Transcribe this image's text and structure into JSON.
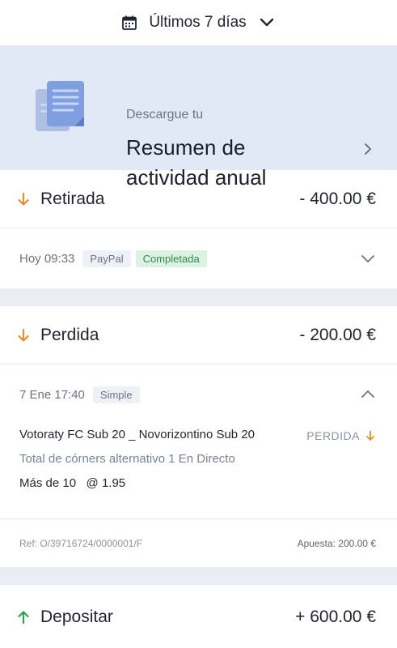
{
  "header": {
    "period_label": "Últimos 7 días",
    "icons": [
      "calendar-icon",
      "chevron-down-icon"
    ]
  },
  "banner": {
    "kicker": "Descargue tu",
    "title": "Resumen de actividad anual",
    "icons": [
      "document-icon",
      "chevron-right-icon"
    ]
  },
  "transactions": [
    {
      "type": "Retirada",
      "amount": "- 400.00 €",
      "direction": "down",
      "date": "Hoy 09:33",
      "badges": [
        "PayPal",
        "Completada"
      ]
    },
    {
      "type": "Perdida",
      "amount": "- 200.00 €",
      "direction": "down",
      "date": "7 Ene 17:40",
      "badges": [
        "Simple"
      ],
      "bet": {
        "match": "Votoraty FC Sub 20 _ Novorizontino Sub 20",
        "result": "PERDIDA",
        "market": "Total de córners alternativo 1 En Directo",
        "selection": "Más de 10   @ 1.95",
        "ref": "Ref: O/39716724/0000001/F",
        "stake": "Apuesta: 200.00 €"
      }
    },
    {
      "type": "Depositar",
      "amount": "+ 600.00 €",
      "direction": "up"
    }
  ],
  "colors": {
    "down_arrow": "#e8912b",
    "up_arrow": "#2fa14f",
    "banner_bg": "#e2e9f6",
    "page_bg": "#e9eef5"
  }
}
